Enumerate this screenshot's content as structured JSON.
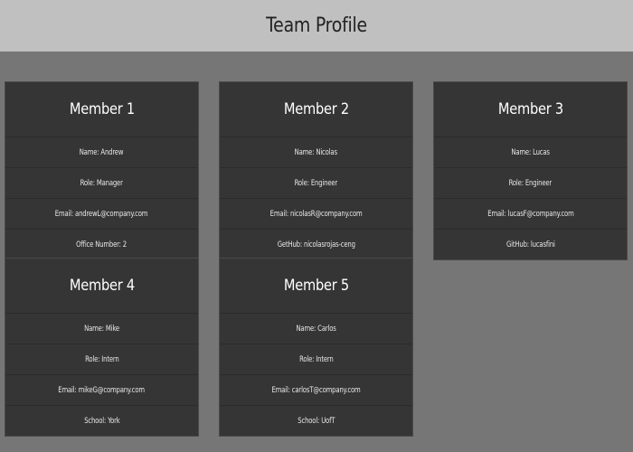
{
  "header": {
    "title": "Team Profile"
  },
  "members": [
    {
      "title": "Member 1",
      "rows": [
        "Name: Andrew",
        "Role: Manager",
        "Email: andrewL@company.com",
        "Office Number: 2"
      ]
    },
    {
      "title": "Member 2",
      "rows": [
        "Name: Nicolas",
        "Role: Engineer",
        "Email: nicolasR@company.com",
        "GetHub: nicolasrojas-ceng"
      ]
    },
    {
      "title": "Member 3",
      "rows": [
        "Name: Lucas",
        "Role: Engineer",
        "Email: lucasF@company.com",
        "GitHub: lucasfini"
      ]
    },
    {
      "title": "Member 4",
      "rows": [
        "Name: Mike",
        "Role: Intern",
        "Email: mikeG@company.com",
        "School: York"
      ]
    },
    {
      "title": "Member 5",
      "rows": [
        "Name: Carlos",
        "Role: Intern",
        "Email: carlosT@company.com",
        "School: UofT"
      ]
    }
  ],
  "colors": {
    "page_background": "#767676",
    "header_background": "#c0c0c0",
    "card_background": "#353535"
  }
}
